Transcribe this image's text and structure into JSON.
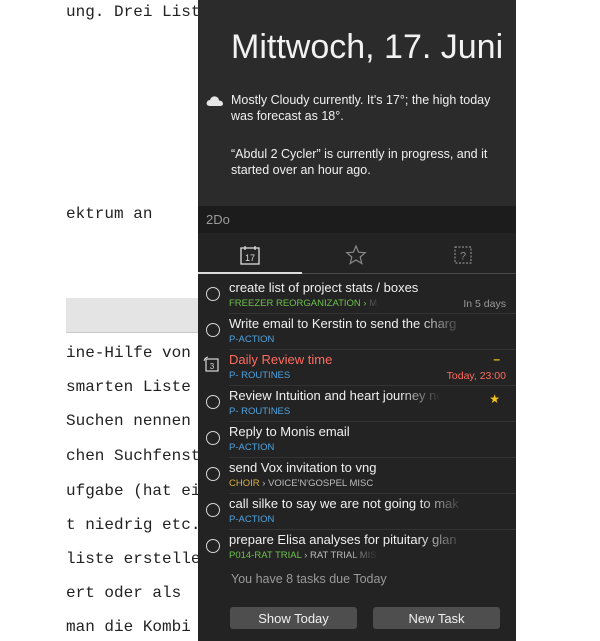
{
  "document": {
    "lines": [
      "ung. Drei List",
      "ektrum an",
      "ine-Hilfe von",
      " smarten Liste",
      "Suchen nennen",
      "chen Suchfenst",
      "ufgabe (hat ei",
      "t niedrig etc.",
      "liste erstelle",
      "ert oder als",
      "man die Kombi"
    ]
  },
  "panel": {
    "date": "Mittwoch, 17. Juni",
    "weather": "Mostly Cloudy currently. It's 17°; the high today was forecast as 18°.",
    "event": "“Abdul 2 Cycler” is currently in progress, and it started over an hour ago.",
    "section_label": "2Do",
    "calendar_day": "17",
    "tasks": [
      {
        "title": "create list of project stats / boxes",
        "list": "FREEZER REORGANIZATION ›",
        "list_tail": " M",
        "due": "In 5 days",
        "list_color": "#6cc04a"
      },
      {
        "title": "Write email to Kerstin to send the charg",
        "list": "P-ACTION",
        "list_tail": "",
        "due": "",
        "list_color": "#4da3e0"
      },
      {
        "title": "Daily Review time",
        "list": "P- ROUTINES",
        "list_tail": "",
        "due": "Today, 23:00",
        "priority": "–",
        "list_color": "#4da3e0"
      },
      {
        "title": "Review Intuition and heart journey note",
        "list": "P- ROUTINES",
        "list_tail": "",
        "due": "",
        "star": "★",
        "list_color": "#4da3e0"
      },
      {
        "title": "Reply to Monis email",
        "list": "P-ACTION",
        "list_tail": "",
        "due": "",
        "list_color": "#4da3e0"
      },
      {
        "title": "send Vox invitation to vng",
        "list": "CHOIR",
        "list_tail": "› VOICE'N'GOSPEL MISC",
        "due": "",
        "list_color": "#d9b23a"
      },
      {
        "title": "call silke to say we are not going to mak",
        "list": "P-ACTION",
        "list_tail": "",
        "due": "",
        "list_color": "#4da3e0"
      },
      {
        "title": "prepare Elisa analyses for pituitary glan",
        "list": "P014-RAT TRIAL",
        "list_tail": "› RAT TRIAL MIS",
        "due": "",
        "list_color": "#6cc04a"
      }
    ],
    "summary": "You have 8 tasks due Today",
    "show_today_label": "Show Today",
    "new_task_label": "New Task",
    "colors": {
      "today_red": "#ff6b5e",
      "overdue_orange": "#ff8a3d",
      "priority_yellow": "#f5c518"
    }
  }
}
